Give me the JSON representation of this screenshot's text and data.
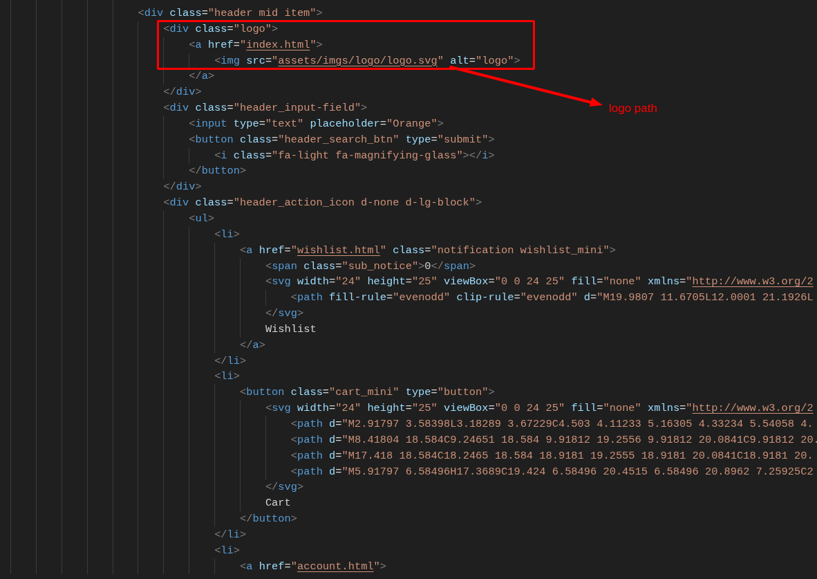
{
  "editor": {
    "lines": [
      {
        "tokens": [
          {
            "kind": "punct",
            "text": "<"
          },
          {
            "kind": "tag",
            "text": "div"
          },
          {
            "kind": "attr",
            "text": " class"
          },
          {
            "kind": "eq",
            "text": "="
          },
          {
            "kind": "string",
            "text": "\"header mid item\""
          },
          {
            "kind": "punct",
            "text": ">"
          }
        ],
        "children": [
          {
            "tokens": [
              {
                "kind": "punct",
                "text": "<"
              },
              {
                "kind": "tag",
                "text": "div"
              },
              {
                "kind": "attr",
                "text": " class"
              },
              {
                "kind": "eq",
                "text": "="
              },
              {
                "kind": "string",
                "text": "\"logo\""
              },
              {
                "kind": "punct",
                "text": ">"
              }
            ],
            "children": [
              {
                "tokens": [
                  {
                    "kind": "punct",
                    "text": "<"
                  },
                  {
                    "kind": "tag",
                    "text": "a"
                  },
                  {
                    "kind": "attr",
                    "text": " href"
                  },
                  {
                    "kind": "eq",
                    "text": "="
                  },
                  {
                    "kind": "string",
                    "text": "\""
                  },
                  {
                    "kind": "link",
                    "text": "index.html"
                  },
                  {
                    "kind": "string",
                    "text": "\""
                  },
                  {
                    "kind": "punct",
                    "text": ">"
                  }
                ],
                "children": [
                  {
                    "tokens": [
                      {
                        "kind": "punct",
                        "text": "<"
                      },
                      {
                        "kind": "tag",
                        "text": "img"
                      },
                      {
                        "kind": "attr",
                        "text": " src"
                      },
                      {
                        "kind": "eq",
                        "text": "="
                      },
                      {
                        "kind": "string",
                        "text": "\""
                      },
                      {
                        "kind": "link",
                        "text": "assets/imgs/logo/logo.svg"
                      },
                      {
                        "kind": "string",
                        "text": "\""
                      },
                      {
                        "kind": "attr",
                        "text": " alt"
                      },
                      {
                        "kind": "eq",
                        "text": "="
                      },
                      {
                        "kind": "string",
                        "text": "\"logo\""
                      },
                      {
                        "kind": "punct",
                        "text": ">"
                      }
                    ]
                  }
                ]
              },
              {
                "tokens": [
                  {
                    "kind": "punct",
                    "text": "</"
                  },
                  {
                    "kind": "tag",
                    "text": "a"
                  },
                  {
                    "kind": "punct",
                    "text": ">"
                  }
                ]
              }
            ]
          },
          {
            "tokens": [
              {
                "kind": "punct",
                "text": "</"
              },
              {
                "kind": "tag",
                "text": "div"
              },
              {
                "kind": "punct",
                "text": ">"
              }
            ]
          },
          {
            "tokens": [
              {
                "kind": "punct",
                "text": "<"
              },
              {
                "kind": "tag",
                "text": "div"
              },
              {
                "kind": "attr",
                "text": " class"
              },
              {
                "kind": "eq",
                "text": "="
              },
              {
                "kind": "string",
                "text": "\"header_input-field\""
              },
              {
                "kind": "punct",
                "text": ">"
              }
            ],
            "children": [
              {
                "tokens": [
                  {
                    "kind": "punct",
                    "text": "<"
                  },
                  {
                    "kind": "tag",
                    "text": "input"
                  },
                  {
                    "kind": "attr",
                    "text": " type"
                  },
                  {
                    "kind": "eq",
                    "text": "="
                  },
                  {
                    "kind": "string",
                    "text": "\"text\""
                  },
                  {
                    "kind": "attr",
                    "text": " placeholder"
                  },
                  {
                    "kind": "eq",
                    "text": "="
                  },
                  {
                    "kind": "string",
                    "text": "\"Orange\""
                  },
                  {
                    "kind": "punct",
                    "text": ">"
                  }
                ]
              },
              {
                "tokens": [
                  {
                    "kind": "punct",
                    "text": "<"
                  },
                  {
                    "kind": "tag",
                    "text": "button"
                  },
                  {
                    "kind": "attr",
                    "text": " class"
                  },
                  {
                    "kind": "eq",
                    "text": "="
                  },
                  {
                    "kind": "string",
                    "text": "\"header_search_btn\""
                  },
                  {
                    "kind": "attr",
                    "text": " type"
                  },
                  {
                    "kind": "eq",
                    "text": "="
                  },
                  {
                    "kind": "string",
                    "text": "\"submit\""
                  },
                  {
                    "kind": "punct",
                    "text": ">"
                  }
                ],
                "children": [
                  {
                    "tokens": [
                      {
                        "kind": "punct",
                        "text": "<"
                      },
                      {
                        "kind": "tag",
                        "text": "i"
                      },
                      {
                        "kind": "attr",
                        "text": " class"
                      },
                      {
                        "kind": "eq",
                        "text": "="
                      },
                      {
                        "kind": "string",
                        "text": "\"fa-light fa-magnifying-glass\""
                      },
                      {
                        "kind": "punct",
                        "text": "></"
                      },
                      {
                        "kind": "tag",
                        "text": "i"
                      },
                      {
                        "kind": "punct",
                        "text": ">"
                      }
                    ]
                  }
                ]
              },
              {
                "tokens": [
                  {
                    "kind": "punct",
                    "text": "</"
                  },
                  {
                    "kind": "tag",
                    "text": "button"
                  },
                  {
                    "kind": "punct",
                    "text": ">"
                  }
                ]
              }
            ]
          },
          {
            "tokens": [
              {
                "kind": "punct",
                "text": "</"
              },
              {
                "kind": "tag",
                "text": "div"
              },
              {
                "kind": "punct",
                "text": ">"
              }
            ]
          },
          {
            "tokens": [
              {
                "kind": "punct",
                "text": "<"
              },
              {
                "kind": "tag",
                "text": "div"
              },
              {
                "kind": "attr",
                "text": " class"
              },
              {
                "kind": "eq",
                "text": "="
              },
              {
                "kind": "string",
                "text": "\"header_action_icon d-none d-lg-block\""
              },
              {
                "kind": "punct",
                "text": ">"
              }
            ],
            "children": [
              {
                "tokens": [
                  {
                    "kind": "punct",
                    "text": "<"
                  },
                  {
                    "kind": "tag",
                    "text": "ul"
                  },
                  {
                    "kind": "punct",
                    "text": ">"
                  }
                ],
                "children": [
                  {
                    "tokens": [
                      {
                        "kind": "punct",
                        "text": "<"
                      },
                      {
                        "kind": "tag",
                        "text": "li"
                      },
                      {
                        "kind": "punct",
                        "text": ">"
                      }
                    ],
                    "children": [
                      {
                        "tokens": [
                          {
                            "kind": "punct",
                            "text": "<"
                          },
                          {
                            "kind": "tag",
                            "text": "a"
                          },
                          {
                            "kind": "attr",
                            "text": " href"
                          },
                          {
                            "kind": "eq",
                            "text": "="
                          },
                          {
                            "kind": "string",
                            "text": "\""
                          },
                          {
                            "kind": "link",
                            "text": "wishlist.html"
                          },
                          {
                            "kind": "string",
                            "text": "\""
                          },
                          {
                            "kind": "attr",
                            "text": " class"
                          },
                          {
                            "kind": "eq",
                            "text": "="
                          },
                          {
                            "kind": "string",
                            "text": "\"notification wishlist_mini\""
                          },
                          {
                            "kind": "punct",
                            "text": ">"
                          }
                        ],
                        "children": [
                          {
                            "tokens": [
                              {
                                "kind": "punct",
                                "text": "<"
                              },
                              {
                                "kind": "tag",
                                "text": "span"
                              },
                              {
                                "kind": "attr",
                                "text": " class"
                              },
                              {
                                "kind": "eq",
                                "text": "="
                              },
                              {
                                "kind": "string",
                                "text": "\"sub_notice\""
                              },
                              {
                                "kind": "punct",
                                "text": ">"
                              },
                              {
                                "kind": "text",
                                "text": "0"
                              },
                              {
                                "kind": "punct",
                                "text": "</"
                              },
                              {
                                "kind": "tag",
                                "text": "span"
                              },
                              {
                                "kind": "punct",
                                "text": ">"
                              }
                            ]
                          },
                          {
                            "tokens": [
                              {
                                "kind": "punct",
                                "text": "<"
                              },
                              {
                                "kind": "tag",
                                "text": "svg"
                              },
                              {
                                "kind": "attr",
                                "text": " width"
                              },
                              {
                                "kind": "eq",
                                "text": "="
                              },
                              {
                                "kind": "string",
                                "text": "\"24\""
                              },
                              {
                                "kind": "attr",
                                "text": " height"
                              },
                              {
                                "kind": "eq",
                                "text": "="
                              },
                              {
                                "kind": "string",
                                "text": "\"25\""
                              },
                              {
                                "kind": "attr",
                                "text": " viewBox"
                              },
                              {
                                "kind": "eq",
                                "text": "="
                              },
                              {
                                "kind": "string",
                                "text": "\"0 0 24 25\""
                              },
                              {
                                "kind": "attr",
                                "text": " fill"
                              },
                              {
                                "kind": "eq",
                                "text": "="
                              },
                              {
                                "kind": "string",
                                "text": "\"none\""
                              },
                              {
                                "kind": "attr",
                                "text": " xmlns"
                              },
                              {
                                "kind": "eq",
                                "text": "="
                              },
                              {
                                "kind": "string",
                                "text": "\""
                              },
                              {
                                "kind": "link",
                                "text": "http://www.w3.org/2"
                              }
                            ],
                            "children": [
                              {
                                "tokens": [
                                  {
                                    "kind": "punct",
                                    "text": "<"
                                  },
                                  {
                                    "kind": "tag",
                                    "text": "path"
                                  },
                                  {
                                    "kind": "attr",
                                    "text": " fill-rule"
                                  },
                                  {
                                    "kind": "eq",
                                    "text": "="
                                  },
                                  {
                                    "kind": "string",
                                    "text": "\"evenodd\""
                                  },
                                  {
                                    "kind": "attr",
                                    "text": " clip-rule"
                                  },
                                  {
                                    "kind": "eq",
                                    "text": "="
                                  },
                                  {
                                    "kind": "string",
                                    "text": "\"evenodd\""
                                  },
                                  {
                                    "kind": "attr",
                                    "text": " d"
                                  },
                                  {
                                    "kind": "eq",
                                    "text": "="
                                  },
                                  {
                                    "kind": "string",
                                    "text": "\"M19.9807 11.6705L12.0001 21.1926L"
                                  }
                                ]
                              }
                            ]
                          },
                          {
                            "tokens": [
                              {
                                "kind": "punct",
                                "text": "</"
                              },
                              {
                                "kind": "tag",
                                "text": "svg"
                              },
                              {
                                "kind": "punct",
                                "text": ">"
                              }
                            ]
                          },
                          {
                            "tokens": [
                              {
                                "kind": "text",
                                "text": "Wishlist"
                              }
                            ]
                          }
                        ]
                      },
                      {
                        "tokens": [
                          {
                            "kind": "punct",
                            "text": "</"
                          },
                          {
                            "kind": "tag",
                            "text": "a"
                          },
                          {
                            "kind": "punct",
                            "text": ">"
                          }
                        ]
                      }
                    ]
                  },
                  {
                    "tokens": [
                      {
                        "kind": "punct",
                        "text": "</"
                      },
                      {
                        "kind": "tag",
                        "text": "li"
                      },
                      {
                        "kind": "punct",
                        "text": ">"
                      }
                    ]
                  },
                  {
                    "tokens": [
                      {
                        "kind": "punct",
                        "text": "<"
                      },
                      {
                        "kind": "tag",
                        "text": "li"
                      },
                      {
                        "kind": "punct",
                        "text": ">"
                      }
                    ],
                    "children": [
                      {
                        "tokens": [
                          {
                            "kind": "punct",
                            "text": "<"
                          },
                          {
                            "kind": "tag",
                            "text": "button"
                          },
                          {
                            "kind": "attr",
                            "text": " class"
                          },
                          {
                            "kind": "eq",
                            "text": "="
                          },
                          {
                            "kind": "string",
                            "text": "\"cart_mini\""
                          },
                          {
                            "kind": "attr",
                            "text": " type"
                          },
                          {
                            "kind": "eq",
                            "text": "="
                          },
                          {
                            "kind": "string",
                            "text": "\"button\""
                          },
                          {
                            "kind": "punct",
                            "text": ">"
                          }
                        ],
                        "children": [
                          {
                            "tokens": [
                              {
                                "kind": "punct",
                                "text": "<"
                              },
                              {
                                "kind": "tag",
                                "text": "svg"
                              },
                              {
                                "kind": "attr",
                                "text": " width"
                              },
                              {
                                "kind": "eq",
                                "text": "="
                              },
                              {
                                "kind": "string",
                                "text": "\"24\""
                              },
                              {
                                "kind": "attr",
                                "text": " height"
                              },
                              {
                                "kind": "eq",
                                "text": "="
                              },
                              {
                                "kind": "string",
                                "text": "\"25\""
                              },
                              {
                                "kind": "attr",
                                "text": " viewBox"
                              },
                              {
                                "kind": "eq",
                                "text": "="
                              },
                              {
                                "kind": "string",
                                "text": "\"0 0 24 25\""
                              },
                              {
                                "kind": "attr",
                                "text": " fill"
                              },
                              {
                                "kind": "eq",
                                "text": "="
                              },
                              {
                                "kind": "string",
                                "text": "\"none\""
                              },
                              {
                                "kind": "attr",
                                "text": " xmlns"
                              },
                              {
                                "kind": "eq",
                                "text": "="
                              },
                              {
                                "kind": "string",
                                "text": "\""
                              },
                              {
                                "kind": "link",
                                "text": "http://www.w3.org/2"
                              }
                            ],
                            "children": [
                              {
                                "tokens": [
                                  {
                                    "kind": "punct",
                                    "text": "<"
                                  },
                                  {
                                    "kind": "tag",
                                    "text": "path"
                                  },
                                  {
                                    "kind": "attr",
                                    "text": " d"
                                  },
                                  {
                                    "kind": "eq",
                                    "text": "="
                                  },
                                  {
                                    "kind": "string",
                                    "text": "\"M2.91797 3.58398L3.18289 3.67229C4.503 4.11233 5.16305 4.33234 5.54058 4."
                                  }
                                ]
                              },
                              {
                                "tokens": [
                                  {
                                    "kind": "punct",
                                    "text": "<"
                                  },
                                  {
                                    "kind": "tag",
                                    "text": "path"
                                  },
                                  {
                                    "kind": "attr",
                                    "text": " d"
                                  },
                                  {
                                    "kind": "eq",
                                    "text": "="
                                  },
                                  {
                                    "kind": "string",
                                    "text": "\"M8.41804 18.584C9.24651 18.584 9.91812 19.2556 9.91812 20.0841C9.91812 20."
                                  }
                                ]
                              },
                              {
                                "tokens": [
                                  {
                                    "kind": "punct",
                                    "text": "<"
                                  },
                                  {
                                    "kind": "tag",
                                    "text": "path"
                                  },
                                  {
                                    "kind": "attr",
                                    "text": " d"
                                  },
                                  {
                                    "kind": "eq",
                                    "text": "="
                                  },
                                  {
                                    "kind": "string",
                                    "text": "\"M17.418 18.584C18.2465 18.584 18.9181 19.2555 18.9181 20.0841C18.9181 20."
                                  }
                                ]
                              },
                              {
                                "tokens": [
                                  {
                                    "kind": "punct",
                                    "text": "<"
                                  },
                                  {
                                    "kind": "tag",
                                    "text": "path"
                                  },
                                  {
                                    "kind": "attr",
                                    "text": " d"
                                  },
                                  {
                                    "kind": "eq",
                                    "text": "="
                                  },
                                  {
                                    "kind": "string",
                                    "text": "\"M5.91797 6.58496H17.3689C19.424 6.58496 20.4515 6.58496 20.8962 7.25925C2"
                                  }
                                ]
                              }
                            ]
                          },
                          {
                            "tokens": [
                              {
                                "kind": "punct",
                                "text": "</"
                              },
                              {
                                "kind": "tag",
                                "text": "svg"
                              },
                              {
                                "kind": "punct",
                                "text": ">"
                              }
                            ]
                          },
                          {
                            "tokens": [
                              {
                                "kind": "text",
                                "text": "Cart"
                              }
                            ]
                          }
                        ]
                      },
                      {
                        "tokens": [
                          {
                            "kind": "punct",
                            "text": "</"
                          },
                          {
                            "kind": "tag",
                            "text": "button"
                          },
                          {
                            "kind": "punct",
                            "text": ">"
                          }
                        ]
                      }
                    ]
                  },
                  {
                    "tokens": [
                      {
                        "kind": "punct",
                        "text": "</"
                      },
                      {
                        "kind": "tag",
                        "text": "li"
                      },
                      {
                        "kind": "punct",
                        "text": ">"
                      }
                    ]
                  },
                  {
                    "tokens": [
                      {
                        "kind": "punct",
                        "text": "<"
                      },
                      {
                        "kind": "tag",
                        "text": "li"
                      },
                      {
                        "kind": "punct",
                        "text": ">"
                      }
                    ],
                    "children": [
                      {
                        "tokens": [
                          {
                            "kind": "punct",
                            "text": "<"
                          },
                          {
                            "kind": "tag",
                            "text": "a"
                          },
                          {
                            "kind": "attr",
                            "text": " href"
                          },
                          {
                            "kind": "eq",
                            "text": "="
                          },
                          {
                            "kind": "string",
                            "text": "\""
                          },
                          {
                            "kind": "link",
                            "text": "account.html"
                          },
                          {
                            "kind": "string",
                            "text": "\""
                          },
                          {
                            "kind": "punct",
                            "text": ">"
                          }
                        ]
                      }
                    ]
                  }
                ]
              }
            ]
          }
        ]
      }
    ]
  },
  "annotation": {
    "label": "logo path"
  }
}
